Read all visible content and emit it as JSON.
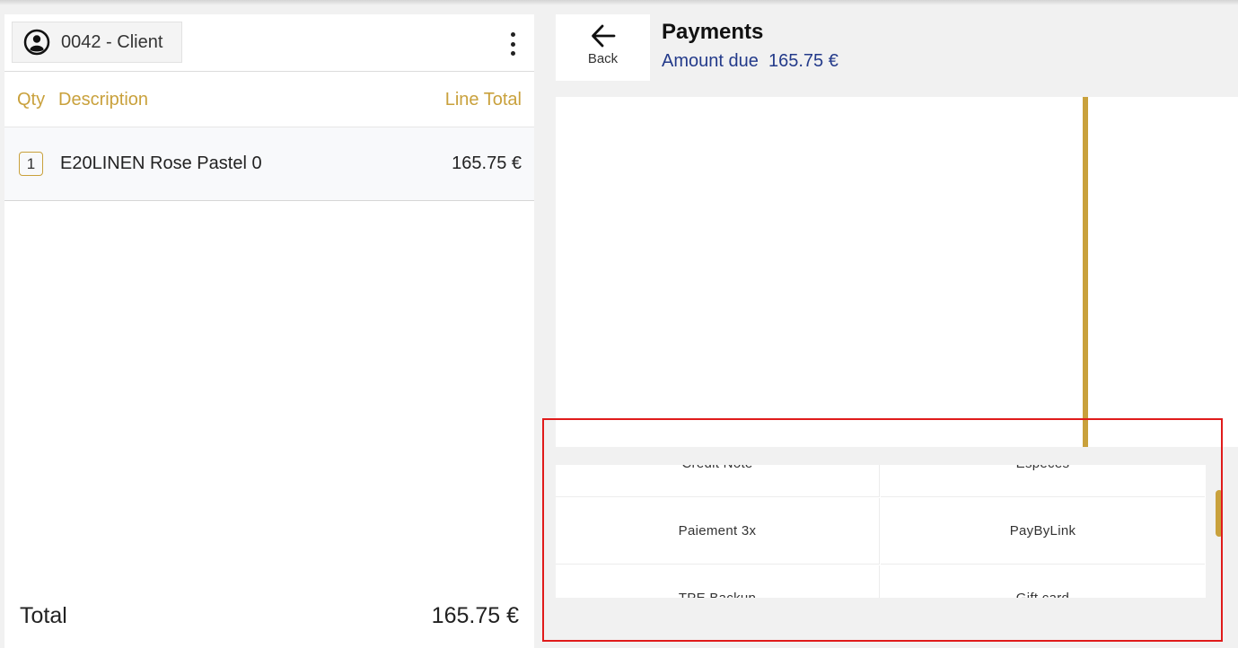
{
  "cart": {
    "client_label": "0042 - Client",
    "columns": {
      "qty": "Qty",
      "description": "Description",
      "line_total": "Line Total"
    },
    "lines": [
      {
        "qty": "1",
        "description": "E20LINEN Rose Pastel 0",
        "total": "165.75 €"
      }
    ],
    "total_label": "Total",
    "total_value": "165.75 €"
  },
  "payments": {
    "back_label": "Back",
    "title": "Payments",
    "amount_due_label": "Amount due",
    "amount_due_value": "165.75 €",
    "methods": [
      {
        "label": "Credit Note"
      },
      {
        "label": "Especes"
      },
      {
        "label": "Paiement 3x"
      },
      {
        "label": "PayByLink"
      },
      {
        "label": "TPE Backup"
      },
      {
        "label": "Gift card"
      }
    ]
  },
  "colors": {
    "accent": "#c9a13c",
    "amount_due": "#233a8a",
    "highlight": "#e01b1b"
  },
  "icons": {
    "client": "user-circle-icon",
    "menu": "kebab-menu-icon",
    "back": "arrow-left-icon"
  }
}
